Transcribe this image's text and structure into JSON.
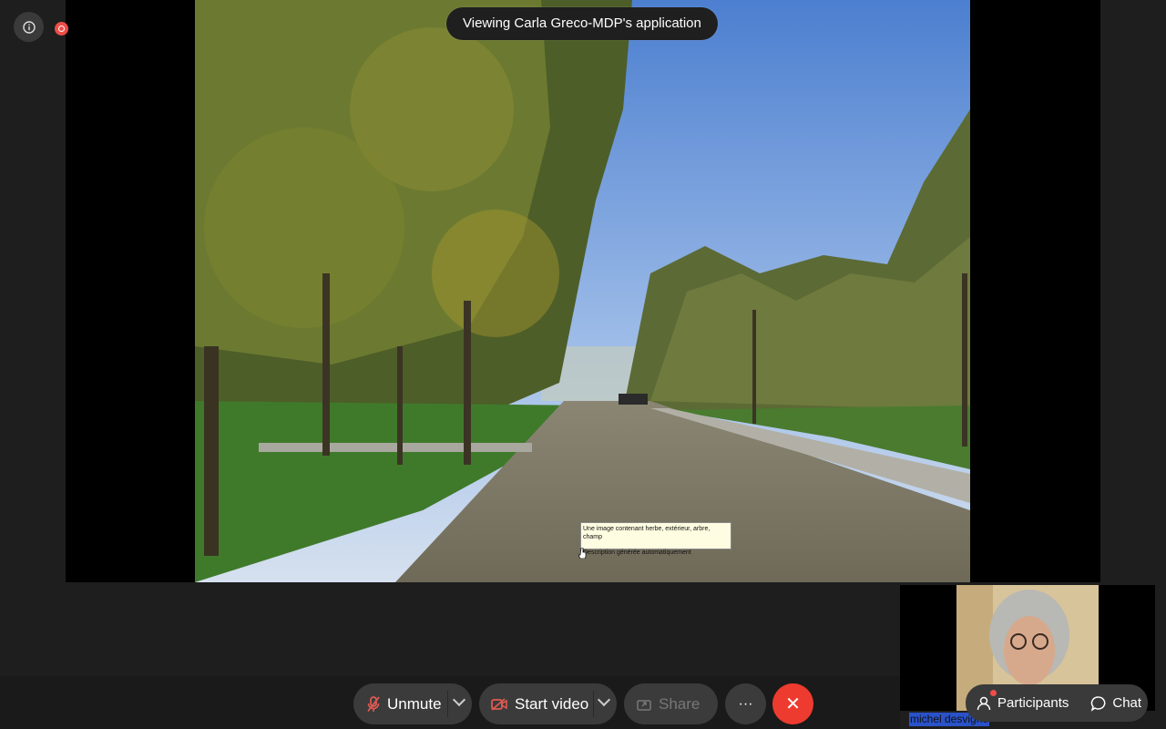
{
  "meeting": {
    "share_banner": "Viewing Carla Greco-MDP's application"
  },
  "shared_content": {
    "tooltip_line1": "Une image contenant herbe, extérieur, arbre, champ",
    "tooltip_line2": "Description générée automatiquement"
  },
  "self_view": {
    "name": "michel desvigne"
  },
  "controls": {
    "unmute_label": "Unmute",
    "start_video_label": "Start video",
    "share_label": "Share",
    "more_label": "···",
    "end_label": "✕"
  },
  "side": {
    "participants_label": "Participants",
    "chat_label": "Chat"
  },
  "colors": {
    "end_red": "#ee3b2f",
    "recording": "#ee4d48",
    "muted_icon": "#e05a52"
  }
}
